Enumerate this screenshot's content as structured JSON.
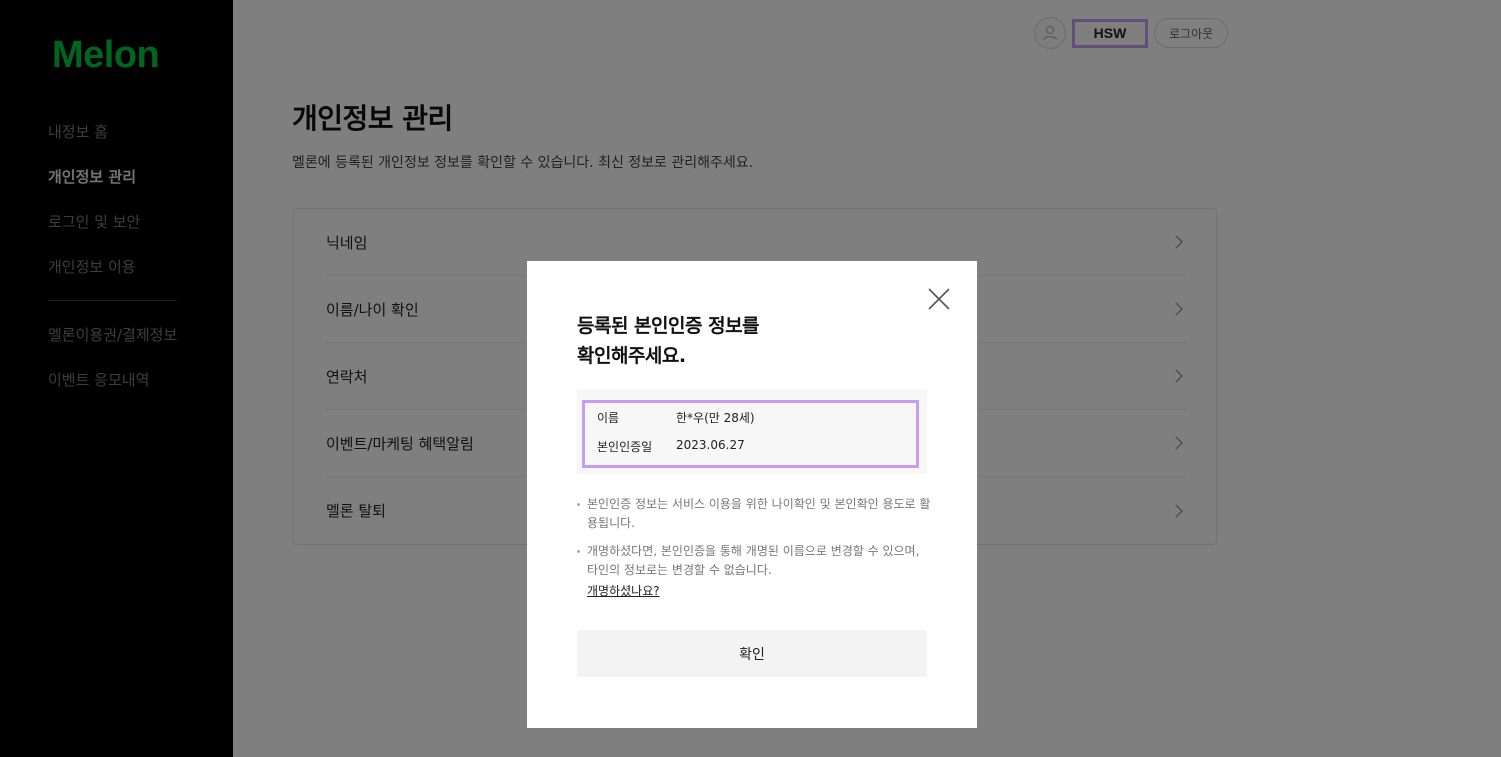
{
  "sidebar": {
    "logo": "Melon",
    "items": [
      {
        "label": "내정보 홈",
        "active": false
      },
      {
        "label": "개인정보 관리",
        "active": true
      },
      {
        "label": "로그인 및 보안",
        "active": false
      },
      {
        "label": "개인정보 이용",
        "active": false
      },
      {
        "label": "멜론이용권/결제정보",
        "active": false
      },
      {
        "label": "이벤트 응모내역",
        "active": false
      }
    ]
  },
  "header": {
    "user_name": "HSW",
    "logout_label": "로그아웃",
    "avatar_icon": "user-icon"
  },
  "main": {
    "title": "개인정보 관리",
    "description": "멜론에 등록된 개인정보 정보를 확인할 수 있습니다. 최신 정보로 관리해주세요.",
    "rows": [
      {
        "label": "닉네임"
      },
      {
        "label": "이름/나이 확인"
      },
      {
        "label": "연락처"
      },
      {
        "label": "이벤트/마케팅 혜택알림"
      },
      {
        "label": "멜론 탈퇴"
      }
    ]
  },
  "modal": {
    "title_line1": "등록된 본인인증 정보를",
    "title_line2": "확인해주세요.",
    "info": {
      "name_label": "이름",
      "name_value": "한*우(만 28세)",
      "date_label": "본인인증일",
      "date_value": "2023.06.27"
    },
    "note1": "본인인증 정보는 서비스 이용을 위한 나이확인 및 본인확인 용도로 활용됩니다.",
    "note2": "개명하셨다면, 본인인증을 통해 개명된 이름으로 변경할 수 있으며, 타인의 정보로는 변경할 수 없습니다.",
    "rename_link": "개명하셨나요?",
    "confirm_label": "확인",
    "close_icon": "close-icon"
  },
  "colors": {
    "brand_green": "#00cd3c",
    "highlight_purple": "#c79cf2",
    "sidebar_bg": "#000000"
  }
}
